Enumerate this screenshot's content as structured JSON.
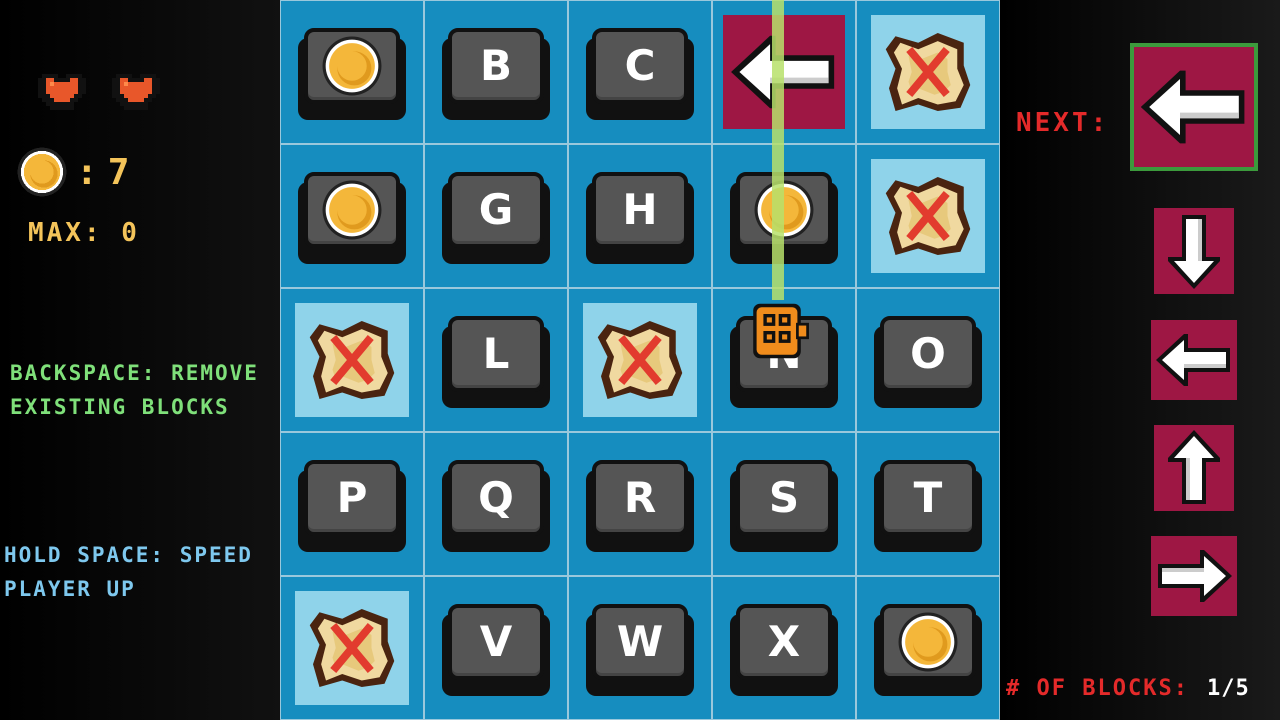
{
  "hud": {
    "lives": 2,
    "coins": "7",
    "coin_separator": ":",
    "max_label": "MAX:",
    "max_value": "0",
    "hint_remove": [
      "BACKSPACE: REMOVE",
      "EXISTING BLOCKS"
    ],
    "hint_speed": [
      "HOLD SPACE: SPEED",
      "PLAYER UP"
    ]
  },
  "grid": {
    "rows": 5,
    "cols": 5,
    "cells": [
      {
        "type": "coin-key"
      },
      {
        "type": "key",
        "label": "B"
      },
      {
        "type": "key",
        "label": "C"
      },
      {
        "type": "arrow",
        "dir": "left"
      },
      {
        "type": "trap"
      },
      {
        "type": "coin-key"
      },
      {
        "type": "key",
        "label": "G"
      },
      {
        "type": "key",
        "label": "H"
      },
      {
        "type": "coin-key"
      },
      {
        "type": "trap"
      },
      {
        "type": "trap"
      },
      {
        "type": "key",
        "label": "L"
      },
      {
        "type": "trap"
      },
      {
        "type": "key",
        "label": "N",
        "player": true
      },
      {
        "type": "key",
        "label": "O"
      },
      {
        "type": "key",
        "label": "P"
      },
      {
        "type": "key",
        "label": "Q"
      },
      {
        "type": "key",
        "label": "R"
      },
      {
        "type": "key",
        "label": "S"
      },
      {
        "type": "key",
        "label": "T"
      },
      {
        "type": "trap"
      },
      {
        "type": "key",
        "label": "V"
      },
      {
        "type": "key",
        "label": "W"
      },
      {
        "type": "key",
        "label": "X"
      },
      {
        "type": "coin-key"
      }
    ]
  },
  "next": {
    "label": "NEXT:",
    "dir": "left"
  },
  "queue": [
    "down",
    "left",
    "up",
    "right"
  ],
  "blocks": {
    "label": "# OF BLOCKS:",
    "count": "1/5"
  },
  "colors": {
    "tile_bg": "#168dbf",
    "arrow_bg": "#9e1744",
    "trap_bg": "#8fd3ea",
    "coin": "#f4b73a",
    "player": "#f08c1c",
    "beam": "#b7e06b"
  }
}
